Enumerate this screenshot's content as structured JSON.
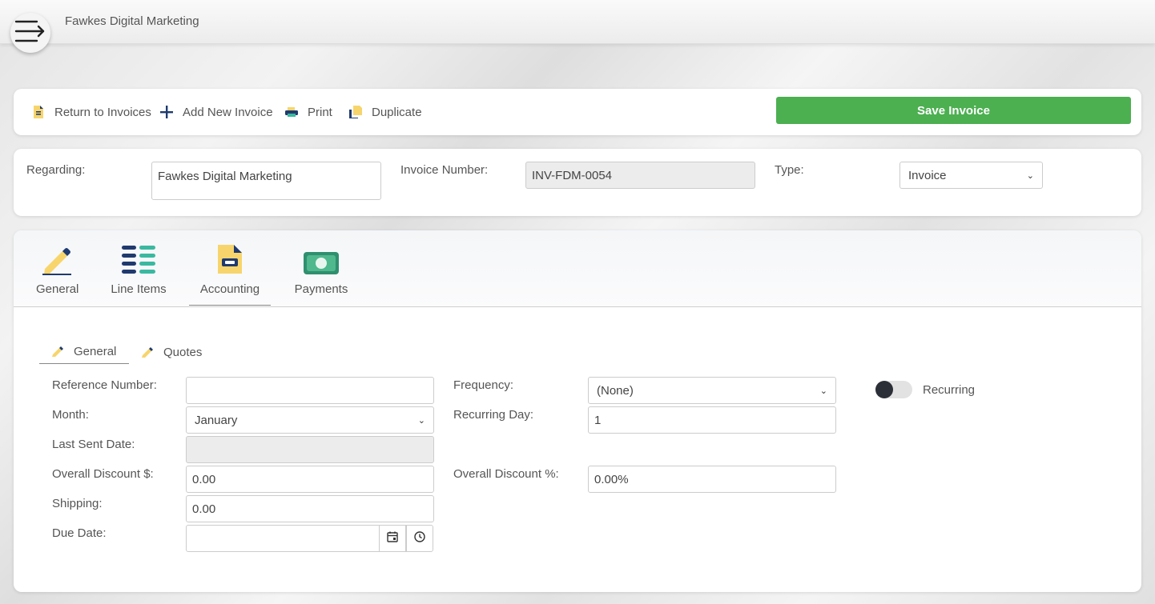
{
  "header": {
    "app_title": "Fawkes Digital Marketing"
  },
  "toolbar": {
    "return_label": "Return to Invoices",
    "add_label": "Add New Invoice",
    "print_label": "Print",
    "duplicate_label": "Duplicate",
    "save_label": "Save Invoice"
  },
  "regarding": {
    "regarding_label": "Regarding:",
    "regarding_value": "Fawkes Digital Marketing",
    "invoice_number_label": "Invoice Number:",
    "invoice_number_value": "INV-FDM-0054",
    "type_label": "Type:",
    "type_value": "Invoice"
  },
  "main_tabs": [
    {
      "label": "General"
    },
    {
      "label": "Line Items"
    },
    {
      "label": "Accounting"
    },
    {
      "label": "Payments"
    }
  ],
  "sub_tabs": [
    {
      "label": "General"
    },
    {
      "label": "Quotes"
    }
  ],
  "form": {
    "reference_number_label": "Reference Number:",
    "reference_number_value": "",
    "month_label": "Month:",
    "month_value": "January",
    "last_sent_date_label": "Last Sent Date:",
    "last_sent_date_value": "",
    "overall_discount_amount_label": "Overall Discount $:",
    "overall_discount_amount_value": "0.00",
    "shipping_label": "Shipping:",
    "shipping_value": "0.00",
    "due_date_label": "Due Date:",
    "due_date_value": "",
    "frequency_label": "Frequency:",
    "frequency_value": "(None)",
    "recurring_day_label": "Recurring Day:",
    "recurring_day_value": "1",
    "overall_discount_percent_label": "Overall Discount %:",
    "overall_discount_percent_value": "0.00%",
    "recurring_label": "Recurring",
    "recurring_on": false
  },
  "colors": {
    "save_green": "#4caf50",
    "navy": "#1f3a6e",
    "teal": "#3ab9a0",
    "yellow": "#f7d56c",
    "money_green": "#2f8f6e"
  }
}
